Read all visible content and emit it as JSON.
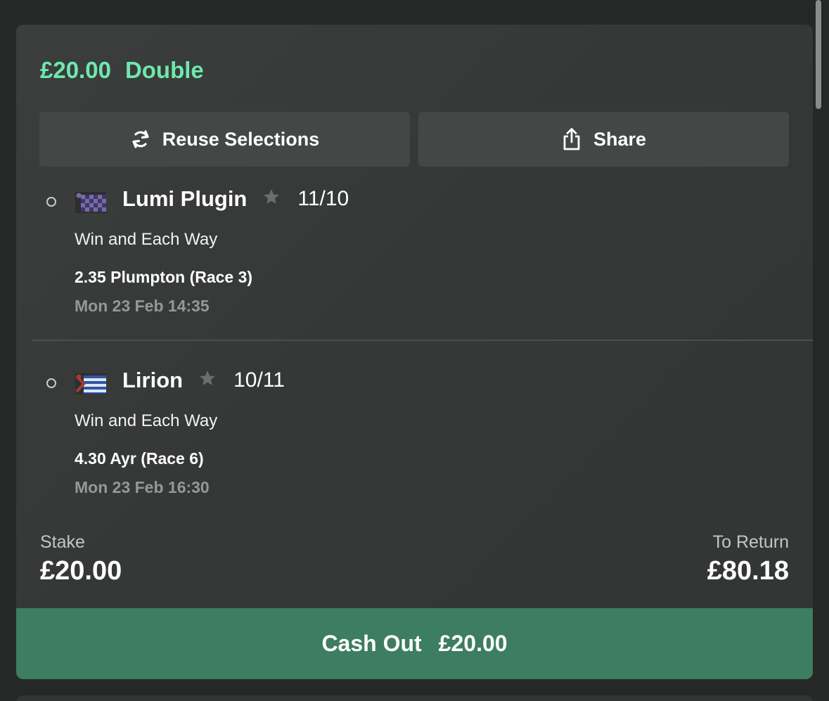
{
  "bet": {
    "stake_amount": "£20.00",
    "bet_type": "Double",
    "accent_color": "#6ee8ac"
  },
  "actions": {
    "reuse_label": "Reuse Selections",
    "reuse_icon": "refresh-icon",
    "share_label": "Share",
    "share_icon": "share-icon"
  },
  "selections": [
    {
      "runner": "Lumi Plugin",
      "odds": "11/10",
      "market": "Win and Each Way",
      "race": "2.35 Plumpton (Race 3)",
      "datetime": "Mon 23 Feb 14:35",
      "silks_icon": "jockey-silks-icon"
    },
    {
      "runner": "Lirion",
      "odds": "10/11",
      "market": "Win and Each Way",
      "race": "4.30 Ayr (Race 6)",
      "datetime": "Mon 23 Feb 16:30",
      "silks_icon": "jockey-silks-icon"
    }
  ],
  "summary": {
    "stake_label": "Stake",
    "stake_value": "£20.00",
    "return_label": "To Return",
    "return_value": "£80.18"
  },
  "cashout": {
    "label": "Cash Out",
    "amount": "£20.00",
    "color": "#3d7d61"
  }
}
